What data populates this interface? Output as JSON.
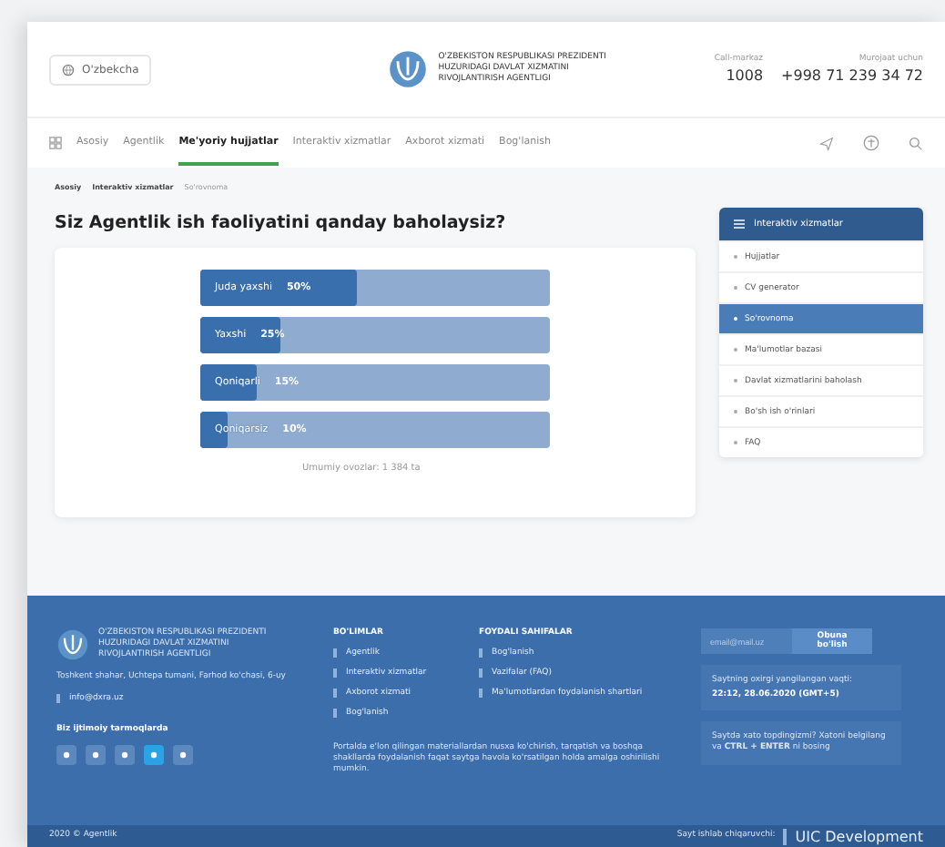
{
  "header": {
    "language": "O'zbekcha",
    "org_name": [
      "O'ZBEKISTON RESPUBLIKASI PREZIDENTI",
      "HUZURIDAGI DAVLAT XIZMATINI",
      "RIVOJLANTIRISH AGENTLIGI"
    ],
    "contacts": [
      {
        "label": "Call-markaz",
        "value": "1008"
      },
      {
        "label": "Murojaat uchun",
        "value": "+998 71 239 34 72"
      }
    ]
  },
  "nav": [
    {
      "label": "Asosiy",
      "selected": false
    },
    {
      "label": "Agentlik",
      "selected": false
    },
    {
      "label": "Me'yoriy hujjatlar",
      "selected": true
    },
    {
      "label": "Interaktiv xizmatlar",
      "selected": false
    },
    {
      "label": "Axborot xizmati",
      "selected": false
    },
    {
      "label": "Bog'lanish",
      "selected": false
    }
  ],
  "breadcrumb": [
    "Asosiy",
    "Interaktiv xizmatlar",
    "So'rovnoma"
  ],
  "title": "Siz Agentlik ish faoliyatini qanday baholaysiz?",
  "poll": {
    "options": [
      {
        "label": "Juda yaxshi",
        "percent": "50%",
        "level": 0.45
      },
      {
        "label": "Yaxshi",
        "percent": "25%",
        "level": 0.23
      },
      {
        "label": "Qoniqarli",
        "percent": "15%",
        "level": 0.16
      },
      {
        "label": "Qoniqarsiz",
        "percent": "10%",
        "level": 0.08
      }
    ],
    "total": "Umumiy ovozlar: 1 384 ta"
  },
  "sidebar": {
    "title": "Interaktiv xizmatlar",
    "items": [
      {
        "label": "Hujjatlar",
        "selected": false
      },
      {
        "label": "CV generator",
        "selected": false
      },
      {
        "label": "So'rovnoma",
        "selected": true
      },
      {
        "label": "Ma'lumotlar bazasi",
        "selected": false
      },
      {
        "label": "Davlat xizmatlarini baholash",
        "selected": false
      },
      {
        "label": "Bo'sh ish o'rinlari",
        "selected": false
      },
      {
        "label": "FAQ",
        "selected": false
      }
    ]
  },
  "footer": {
    "org_name": [
      "O'ZBEKISTON RESPUBLIKASI PREZIDENTI",
      "HUZURIDAGI DAVLAT XIZMATINI",
      "RIVOJLANTIRISH AGENTLIGI"
    ],
    "address": "Toshkent shahar, Uchtepa tumani, Farhod ko'chasi, 6-uy",
    "email": "info@dxra.uz",
    "social_title": "Biz ijtimoiy tarmoqlarda",
    "columns": [
      {
        "title": "BO'LIMLAR",
        "links": [
          "Agentlik",
          "Interaktiv xizmatlar",
          "Axborot xizmati",
          "Bog'lanish"
        ]
      },
      {
        "title": "FOYDALI SAHIFALAR",
        "links": [
          "Bog'lanish",
          "Vazifalar (FAQ)",
          "Ma'lumotlardan foydalanish shartlari"
        ]
      }
    ],
    "notice": "Portalda e'lon qilingan materiallardan nusxa ko'chirish, tarqatish va boshqa shakllarda foydalanish faqat saytga havola ko'rsatilgan holda amalga oshirilishi mumkin.",
    "subscribe": {
      "placeholder": "email@mail.uz",
      "button": "Obuna bo'lish"
    },
    "updated_label": "Saytning oxirgi yangilangan vaqti:",
    "updated_value": "22:12, 28.06.2020 (GMT+5)",
    "error_hint": "Saytda xato topdingizmi? Xatoni belgilang va **CTRL + ENTER** ni bosing",
    "copyright": "2020 © Agentlik",
    "developer_label": "Sayt ishlab chiqaruvchi:",
    "developer": "UIC Development"
  }
}
